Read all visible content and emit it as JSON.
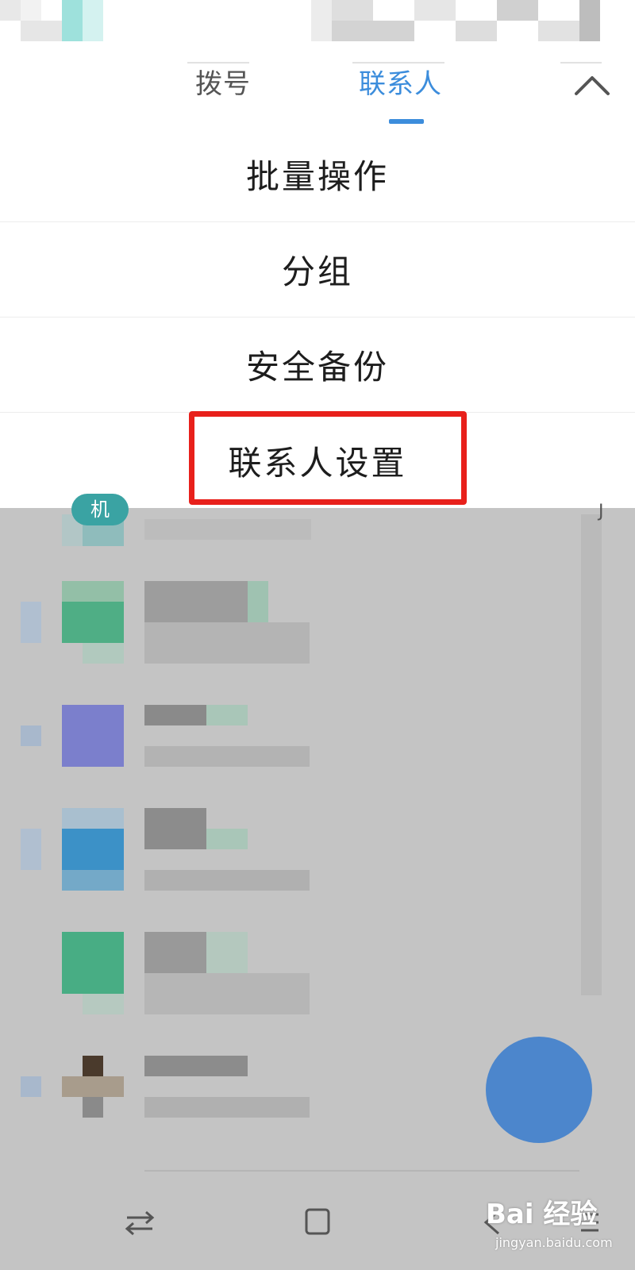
{
  "header": {
    "tabs": [
      {
        "label": "拨号",
        "active": false
      },
      {
        "label": "联系人",
        "active": true
      }
    ],
    "collapse_icon": "chevron-up-icon"
  },
  "menu": {
    "items": [
      {
        "label": "批量操作"
      },
      {
        "label": "分组"
      },
      {
        "label": "安全备份"
      },
      {
        "label": "联系人设置",
        "highlighted": true
      }
    ]
  },
  "contacts": {
    "group_badge": "机",
    "index_letter": "J"
  },
  "navbar": {
    "icons": [
      "switch-apps-icon",
      "home-square-icon",
      "back-icon",
      "menu-icon"
    ]
  },
  "watermark": {
    "brand": "Bai 经验",
    "url": "jingyan.baidu.com"
  },
  "colors": {
    "accent": "#3c8ddc",
    "highlight_border": "#e8201b",
    "dim_overlay": "#c4c4c4"
  }
}
